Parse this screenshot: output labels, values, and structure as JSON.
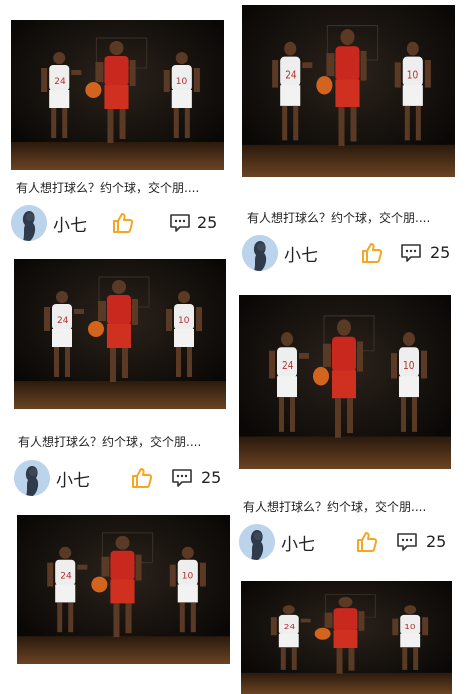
{
  "feed": {
    "cards": [
      {
        "caption": "有人想打球么？约个球，交个朋....",
        "author": "小七",
        "comments": "25",
        "photo_alt": "basketball-players-photo"
      },
      {
        "caption": "有人想打球么？约个球，交个朋....",
        "author": "小七",
        "comments": "25",
        "photo_alt": "basketball-players-photo"
      },
      {
        "caption": "有人想打球么？约个球，交个朋....",
        "author": "小七",
        "comments": "25",
        "photo_alt": "basketball-players-photo"
      },
      {
        "caption": "有人想打球么？约个球，交个朋....",
        "author": "小七",
        "comments": "25",
        "photo_alt": "basketball-players-photo"
      },
      {
        "photo_alt": "basketball-players-photo"
      },
      {
        "photo_alt": "basketball-players-photo"
      }
    ]
  },
  "icons": {
    "like": "thumbs-up-icon",
    "comment": "comment-bubble-icon",
    "avatar": "user-avatar"
  },
  "colors": {
    "like": "#f5a623",
    "text": "#222222",
    "photo_bg": "#0d0a08"
  }
}
